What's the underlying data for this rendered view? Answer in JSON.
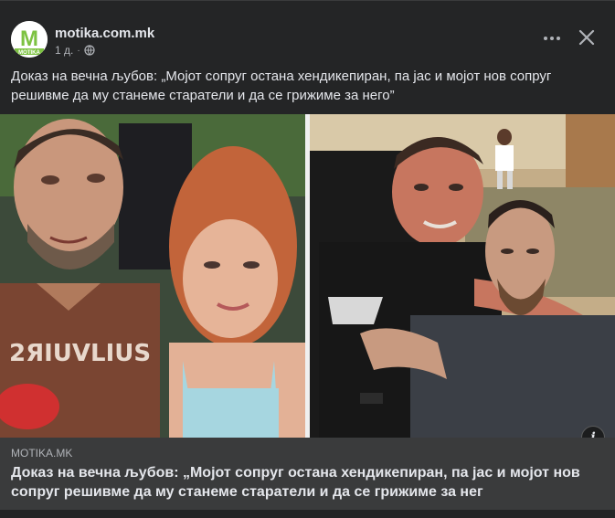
{
  "post": {
    "page_name": "motika.com.mk",
    "time": "1 д.",
    "separator": "·",
    "privacy_icon": "globe-icon",
    "text": "Доказ на вечна љубов: „Мојот сопруг остана хендикепиран, па јас и мојот нов сопруг решивме да му станеме старатели и да се грижиме за него”"
  },
  "avatar": {
    "logo_letter": "M",
    "logo_text": "MOTIKA",
    "brand_color": "#7dc242"
  },
  "controls": {
    "more_icon": "more-horizontal-icon",
    "close_icon": "close-icon",
    "info_label": "i"
  },
  "link_preview": {
    "domain": "MOTIKA.MK",
    "title": "Доказ на вечна љубов: „Мојот сопруг остана хендикепиран, па јас и мојот нов сопруг решивме да му станеме старатели и да се грижиме за нег"
  },
  "photo_left": {
    "shirt_text": "2ЯIUVLIUS"
  },
  "colors": {
    "card_bg": "#242526",
    "preview_bg": "#3a3b3c",
    "text": "#e4e6eb",
    "muted": "#b0b3b8"
  }
}
